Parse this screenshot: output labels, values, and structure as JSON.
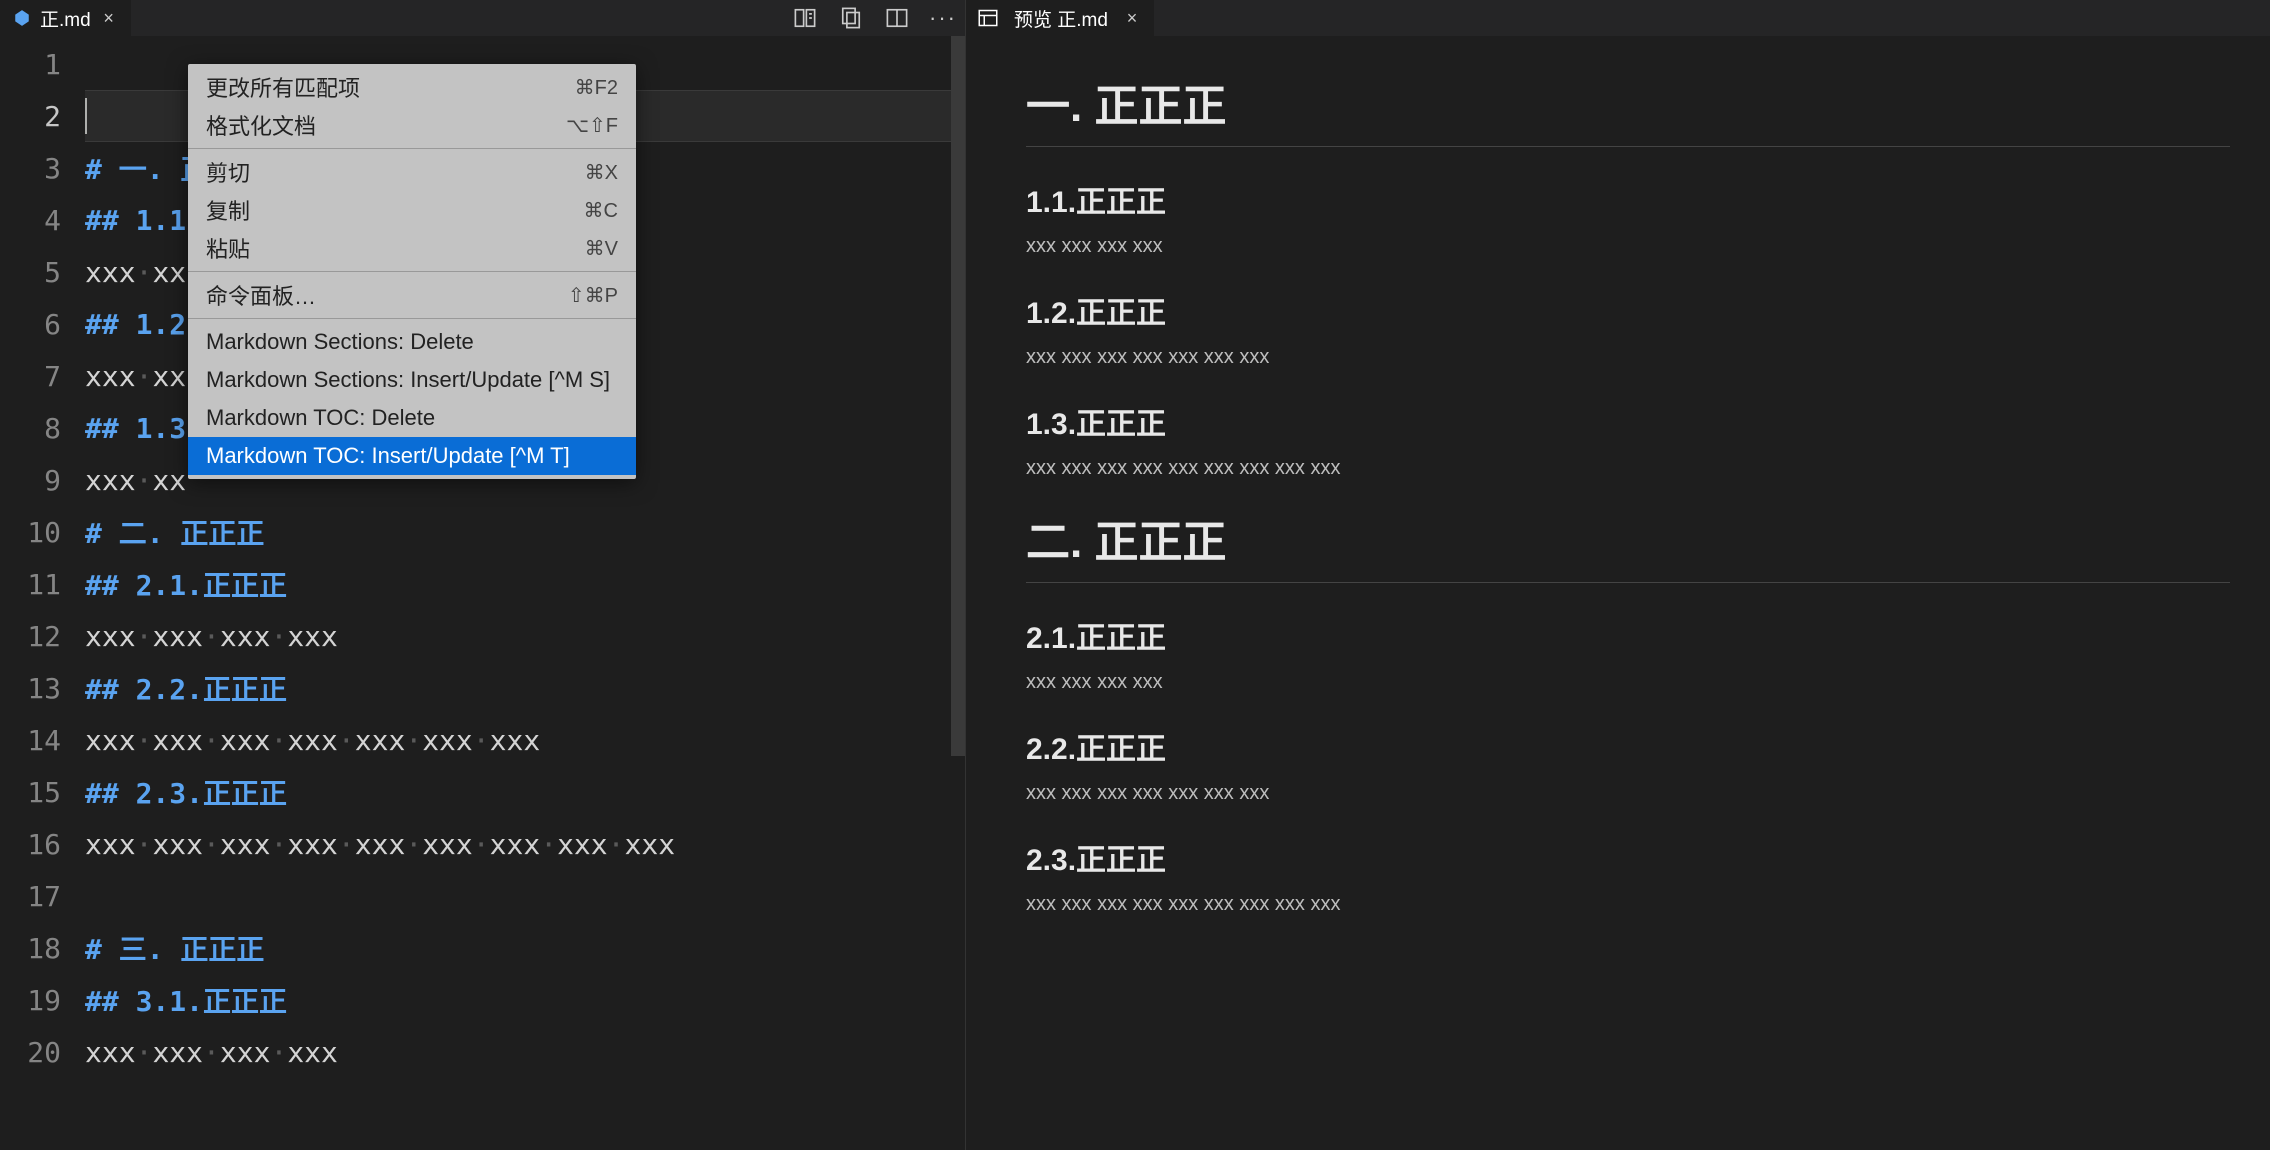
{
  "editor": {
    "tab": {
      "filename": "正.md"
    },
    "lines": [
      {
        "n": 1,
        "type": "empty"
      },
      {
        "n": 2,
        "type": "cursor"
      },
      {
        "n": 3,
        "type": "head",
        "text": "# 一. 正"
      },
      {
        "n": 4,
        "type": "head",
        "text": "## 1.1"
      },
      {
        "n": 5,
        "type": "body",
        "text": "xxx·xx"
      },
      {
        "n": 6,
        "type": "head",
        "text": "## 1.2"
      },
      {
        "n": 7,
        "type": "body",
        "text": "xxx·xx"
      },
      {
        "n": 8,
        "type": "head",
        "text": "## 1.3"
      },
      {
        "n": 9,
        "type": "body",
        "text": "xxx·xx"
      },
      {
        "n": 10,
        "type": "head",
        "text": "# 二. 正正正"
      },
      {
        "n": 11,
        "type": "head",
        "text": "## 2.1.正正正"
      },
      {
        "n": 12,
        "type": "body",
        "text": "xxx·xxx·xxx·xxx"
      },
      {
        "n": 13,
        "type": "head",
        "text": "## 2.2.正正正"
      },
      {
        "n": 14,
        "type": "body",
        "text": "xxx·xxx·xxx·xxx·xxx·xxx·xxx"
      },
      {
        "n": 15,
        "type": "head",
        "text": "## 2.3.正正正"
      },
      {
        "n": 16,
        "type": "body",
        "text": "xxx·xxx·xxx·xxx·xxx·xxx·xxx·xxx·xxx"
      },
      {
        "n": 17,
        "type": "empty"
      },
      {
        "n": 18,
        "type": "head",
        "text": "# 三. 正正正"
      },
      {
        "n": 19,
        "type": "head",
        "text": "## 3.1.正正正"
      },
      {
        "n": 20,
        "type": "body",
        "text": "xxx·xxx·xxx·xxx"
      }
    ]
  },
  "contextMenu": {
    "groups": [
      [
        {
          "label": "更改所有匹配项",
          "shortcut": "⌘F2"
        },
        {
          "label": "格式化文档",
          "shortcut": "⌥⇧F"
        }
      ],
      [
        {
          "label": "剪切",
          "shortcut": "⌘X"
        },
        {
          "label": "复制",
          "shortcut": "⌘C"
        },
        {
          "label": "粘贴",
          "shortcut": "⌘V"
        }
      ],
      [
        {
          "label": "命令面板…",
          "shortcut": "⇧⌘P"
        }
      ],
      [
        {
          "label": "Markdown Sections: Delete",
          "shortcut": ""
        },
        {
          "label": "Markdown Sections: Insert/Update [^M S]",
          "shortcut": ""
        },
        {
          "label": "Markdown TOC: Delete",
          "shortcut": ""
        },
        {
          "label": "Markdown TOC: Insert/Update [^M T]",
          "shortcut": "",
          "highlighted": true
        }
      ]
    ]
  },
  "preview": {
    "tab": {
      "title": "预览 正.md"
    },
    "blocks": [
      {
        "tag": "h1",
        "text": "一. 正正正"
      },
      {
        "tag": "h2",
        "text": "1.1.正正正"
      },
      {
        "tag": "p",
        "text": "xxx xxx xxx xxx"
      },
      {
        "tag": "h2",
        "text": "1.2.正正正"
      },
      {
        "tag": "p",
        "text": "xxx xxx xxx xxx xxx xxx xxx"
      },
      {
        "tag": "h2",
        "text": "1.3.正正正"
      },
      {
        "tag": "p",
        "text": "xxx xxx xxx xxx xxx xxx xxx xxx xxx"
      },
      {
        "tag": "h1",
        "text": "二. 正正正"
      },
      {
        "tag": "h2",
        "text": "2.1.正正正"
      },
      {
        "tag": "p",
        "text": "xxx xxx xxx xxx"
      },
      {
        "tag": "h2",
        "text": "2.2.正正正"
      },
      {
        "tag": "p",
        "text": "xxx xxx xxx xxx xxx xxx xxx"
      },
      {
        "tag": "h2",
        "text": "2.3.正正正"
      },
      {
        "tag": "p",
        "text": "xxx xxx xxx xxx xxx xxx xxx xxx xxx"
      }
    ]
  },
  "icons": {
    "markdown": "▾",
    "close": "×",
    "splitPreview": "⿰",
    "diff": "⧉",
    "splitRight": "◫",
    "more": "···",
    "previewPanel": "▦"
  }
}
